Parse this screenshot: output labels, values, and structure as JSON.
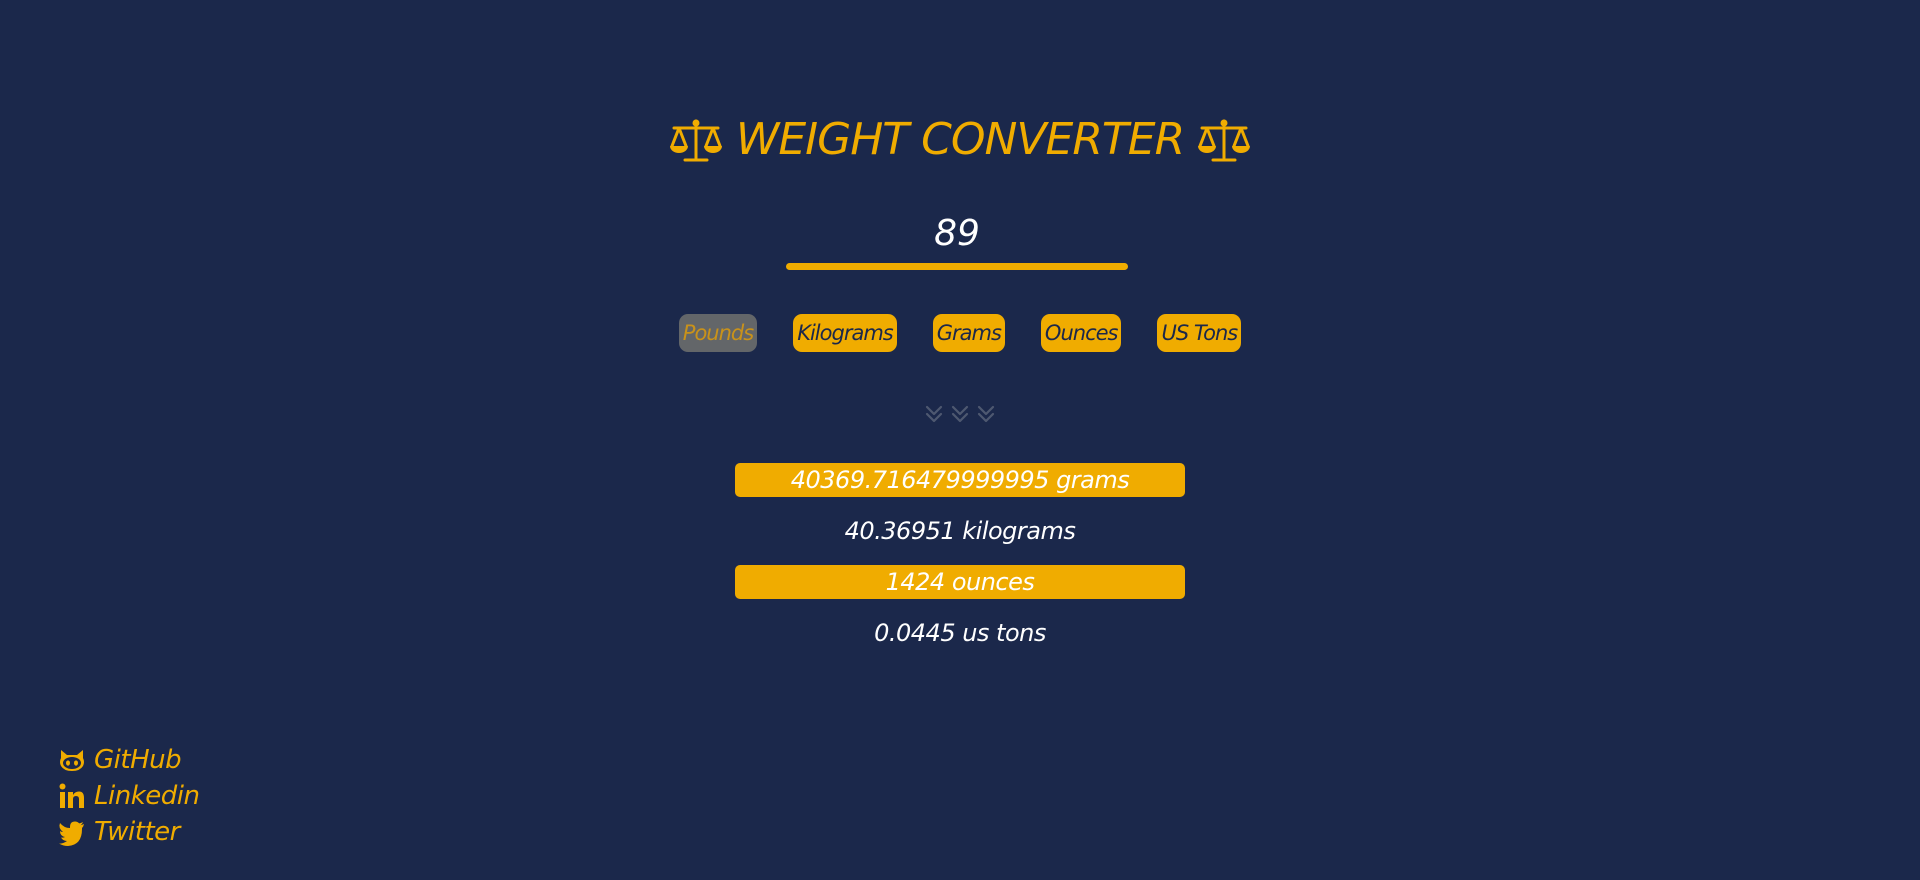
{
  "header": {
    "title": "WEIGHT CONVERTER",
    "icon": "scale-balance-icon"
  },
  "input": {
    "value": "89"
  },
  "units": [
    {
      "label": "Pounds",
      "active": true
    },
    {
      "label": "Kilograms",
      "active": false
    },
    {
      "label": "Grams",
      "active": false
    },
    {
      "label": "Ounces",
      "active": false
    },
    {
      "label": "US Tons",
      "active": false
    }
  ],
  "divider_icon": "chevrons-down-icon",
  "results": [
    {
      "text": "40369.716479999995 grams",
      "highlighted": true
    },
    {
      "text": "40.36951 kilograms",
      "highlighted": false
    },
    {
      "text": "1424 ounces",
      "highlighted": true
    },
    {
      "text": "0.0445 us tons",
      "highlighted": false
    }
  ],
  "social": [
    {
      "label": "GitHub",
      "icon": "github-icon"
    },
    {
      "label": "Linkedin",
      "icon": "linkedin-icon"
    },
    {
      "label": "Twitter",
      "icon": "twitter-icon"
    }
  ],
  "colors": {
    "background": "#1b284b",
    "accent": "#f0ac00",
    "active_button": "#636669",
    "text": "#ffffff"
  }
}
